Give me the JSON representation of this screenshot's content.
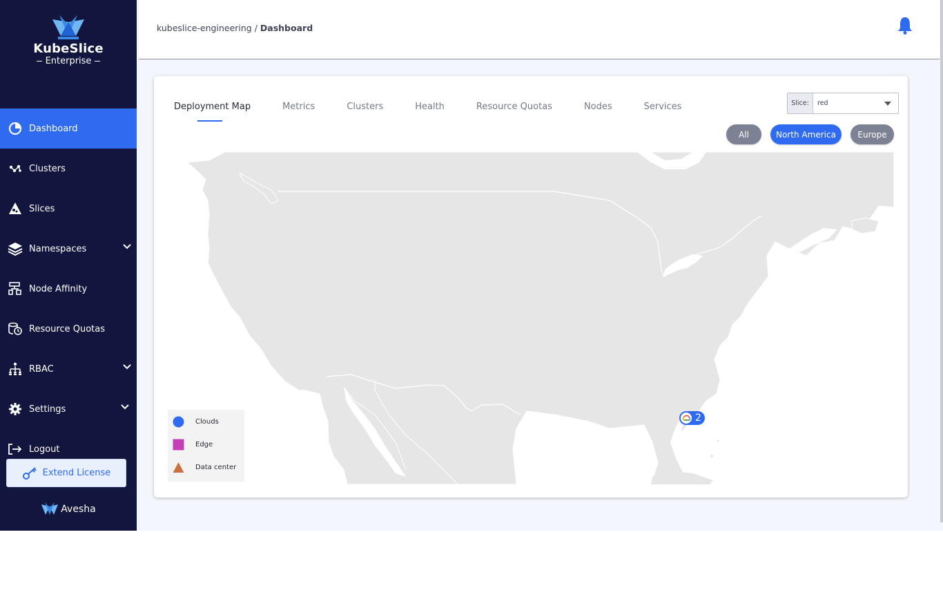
{
  "sidebar": {
    "brand": "KubeSlice",
    "edition": "Enterprise",
    "items": [
      {
        "label": "Dashboard",
        "icon": "pie-chart-icon"
      },
      {
        "label": "Clusters",
        "icon": "cluster-nodes-icon"
      },
      {
        "label": "Slices",
        "icon": "slices-icon"
      },
      {
        "label": "Namespaces",
        "icon": "layers-icon"
      },
      {
        "label": "Node Affinity",
        "icon": "hierarchy-icon"
      },
      {
        "label": "Resource Quotas",
        "icon": "quota-icon"
      },
      {
        "label": "RBAC",
        "icon": "people-tree-icon"
      },
      {
        "label": "Settings",
        "icon": "gear-icon"
      },
      {
        "label": "Logout",
        "icon": "logout-icon"
      }
    ],
    "license_button": "Extend License",
    "footer_brand": "Avesha"
  },
  "header": {
    "breadcrumb_root": "kubeslice-engineering",
    "breadcrumb_separator": " / ",
    "breadcrumb_current": "Dashboard"
  },
  "tabs": [
    "Deployment Map",
    "Metrics",
    "Clusters",
    "Health",
    "Resource Quotas",
    "Nodes",
    "Services"
  ],
  "slice_filter": {
    "label": "Slice:",
    "value": "red"
  },
  "regions": [
    "All",
    "North America",
    "Europe"
  ],
  "selected_region": "North America",
  "map": {
    "cluster_count": "2",
    "legend": [
      {
        "label": "Clouds",
        "color": "#2f6bf0",
        "shape": "circle"
      },
      {
        "label": "Edge",
        "color": "#c43fb5",
        "shape": "square"
      },
      {
        "label": "Data center",
        "color": "#c87040",
        "shape": "triangle"
      }
    ]
  },
  "colors": {
    "sidebar": "#12163f",
    "accent": "#2f6bf0",
    "land": "#e6e6e6"
  }
}
